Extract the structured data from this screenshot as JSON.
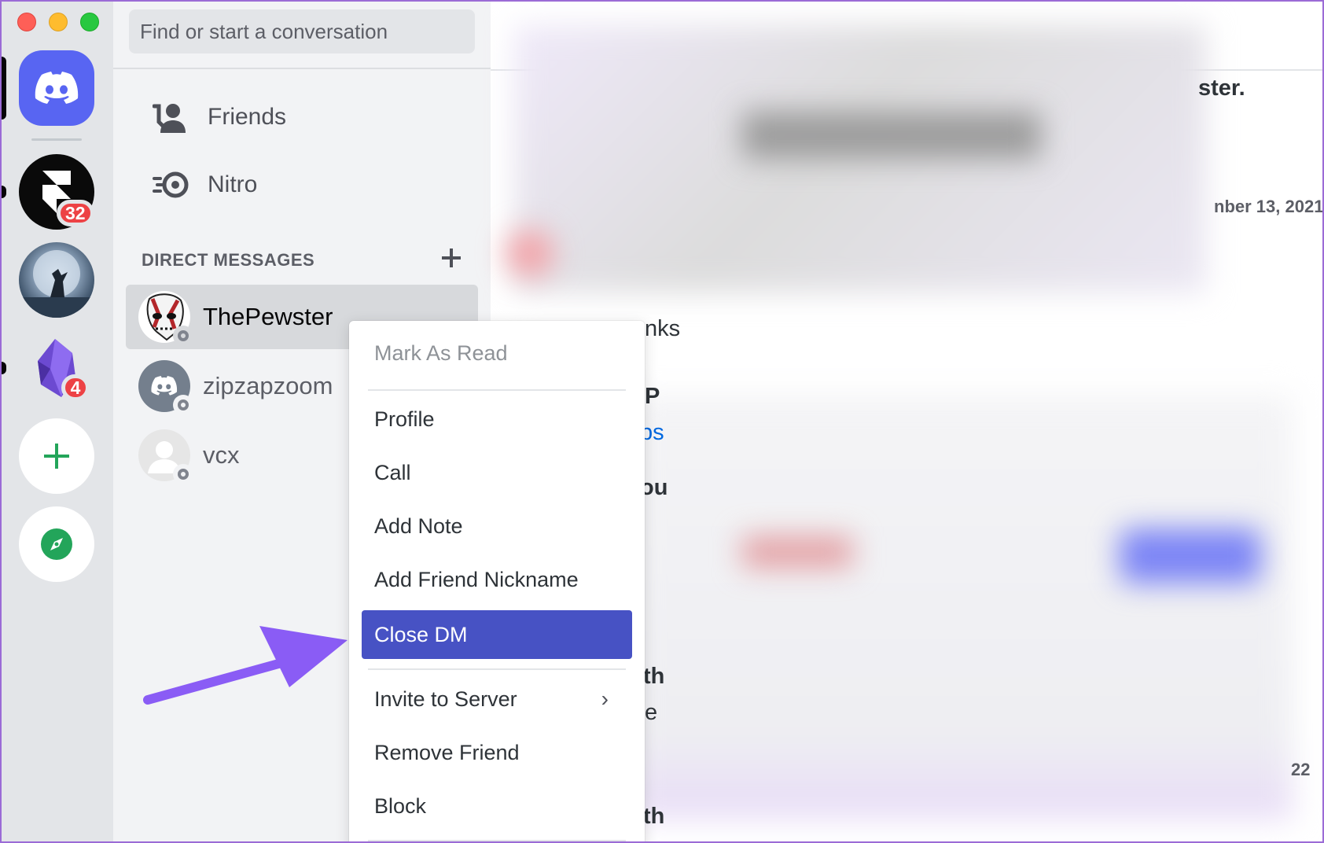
{
  "search": {
    "placeholder": "Find or start a conversation"
  },
  "nav": [
    {
      "label": "Friends",
      "icon": "friends-icon"
    },
    {
      "label": "Nitro",
      "icon": "nitro-icon"
    }
  ],
  "direct_messages": {
    "header": "DIRECT MESSAGES",
    "add_icon": "plus-icon",
    "items": [
      {
        "name": "ThePewster",
        "active": true
      },
      {
        "name": "zipzapzoom",
        "active": false
      },
      {
        "name": "vcx",
        "active": false
      }
    ]
  },
  "servers": {
    "framer_badge": "32",
    "obsidian_badge": "4"
  },
  "chat": {
    "fragment_1": "ster.",
    "fragment_2": "nber 13, 2021",
    "fragment_3": "nks",
    "fragment_4": "P",
    "fragment_5": "ps",
    "fragment_6": "ou",
    "fragment_7": "th",
    "fragment_8": "e",
    "fragment_9": "22",
    "fragment_10": "th"
  },
  "context_menu": {
    "items": [
      {
        "label": "Mark As Read",
        "state": "disabled"
      },
      {
        "label": "Profile"
      },
      {
        "label": "Call"
      },
      {
        "label": "Add Note"
      },
      {
        "label": "Add Friend Nickname"
      },
      {
        "label": "Close DM",
        "state": "selected"
      },
      {
        "label": "Invite to Server",
        "has_submenu": true
      },
      {
        "label": "Remove Friend"
      },
      {
        "label": "Block"
      }
    ]
  },
  "colors": {
    "blurple": "#5865f2",
    "menu_highlight": "#4752c4",
    "badge_red": "#ed4245",
    "annotation_purple": "#8a5cf5",
    "add_server_green": "#23a55a"
  }
}
